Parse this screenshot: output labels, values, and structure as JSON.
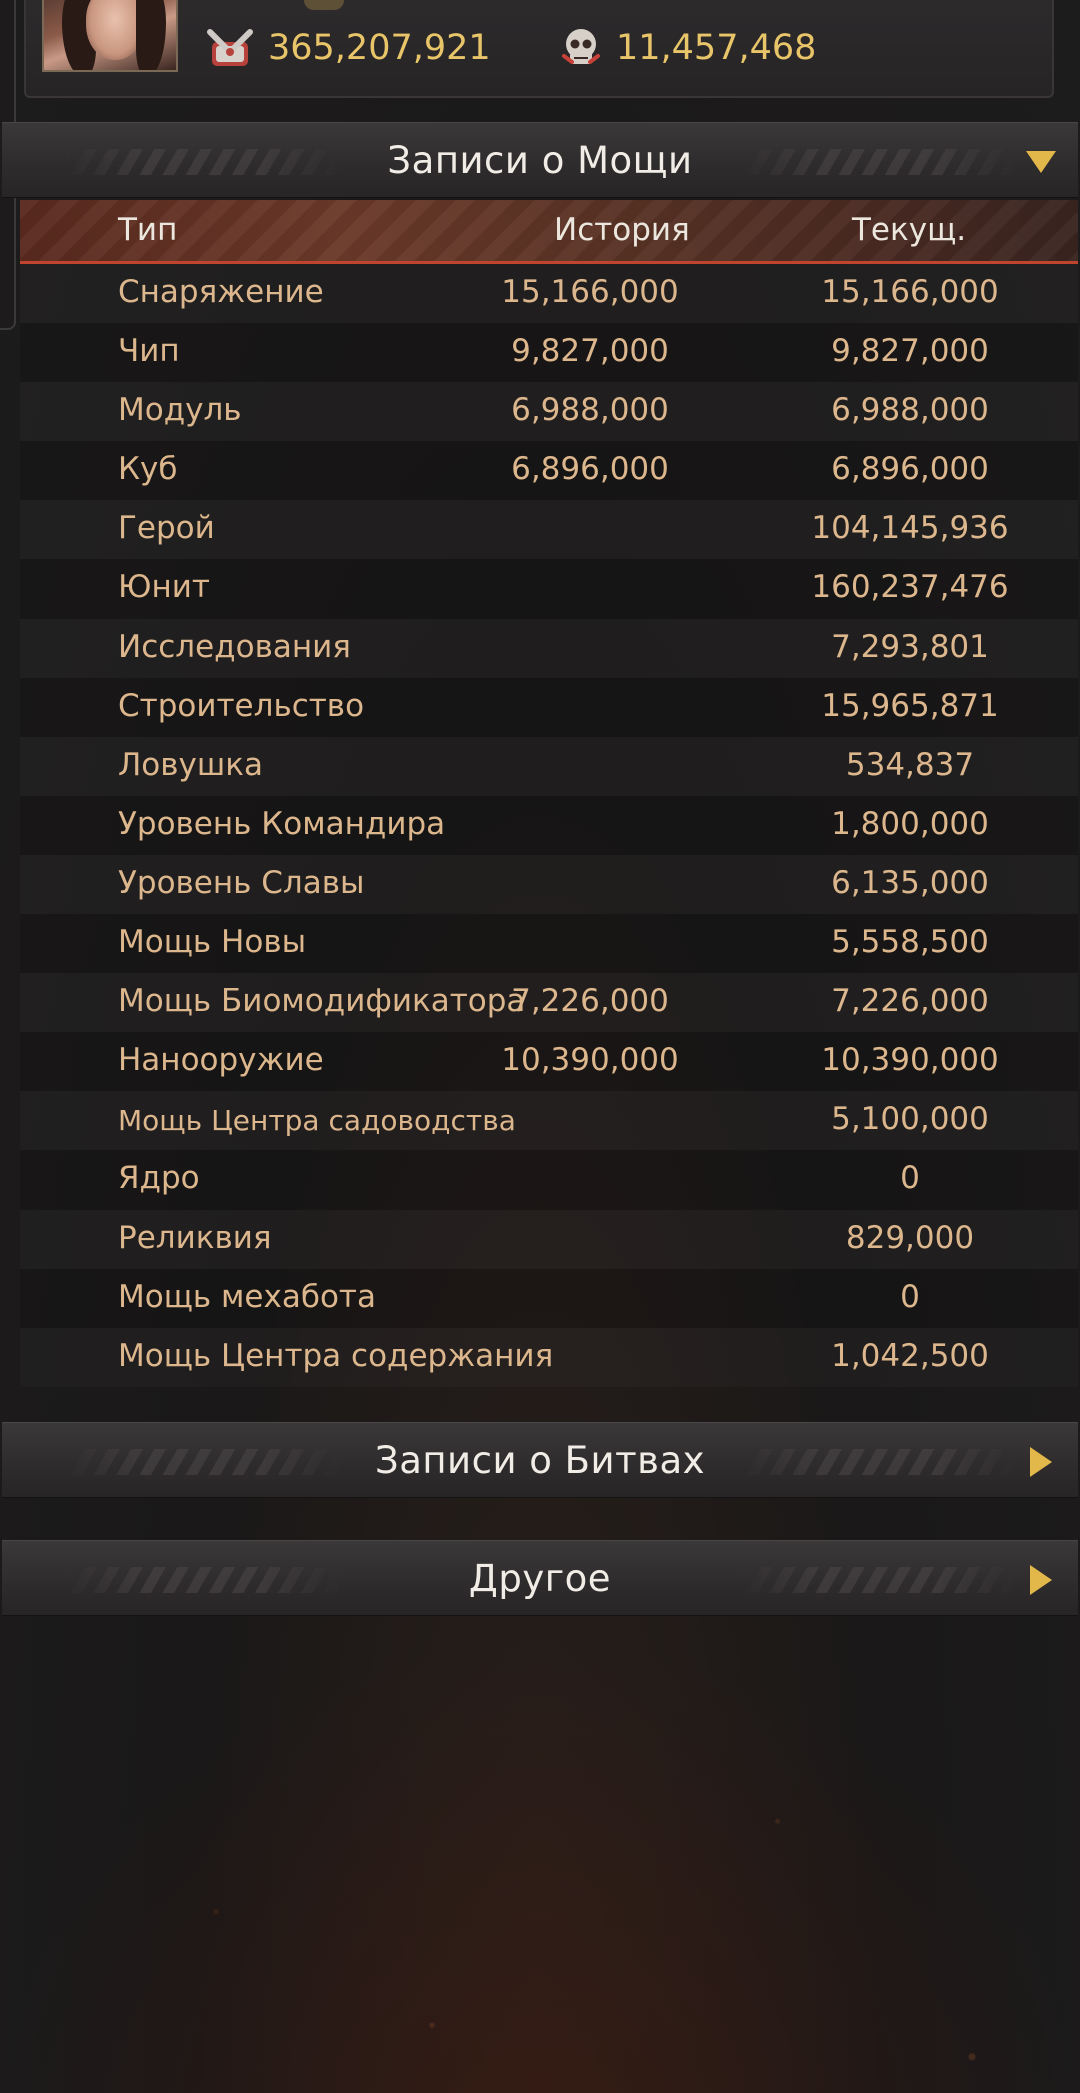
{
  "profile": {
    "stats": [
      {
        "icon": "power-fist-icon",
        "value": "365,207,921"
      },
      {
        "icon": "skull-kills-icon",
        "value": "11,457,468"
      }
    ]
  },
  "power_section": {
    "title": "Записи о Мощи",
    "expanded": true,
    "columns": {
      "type": "Тип",
      "history": "История",
      "current": "Текущ."
    },
    "rows": [
      {
        "type": "Снаряжение",
        "history": "15,166,000",
        "current": "15,166,000"
      },
      {
        "type": "Чип",
        "history": "9,827,000",
        "current": "9,827,000"
      },
      {
        "type": "Модуль",
        "history": "6,988,000",
        "current": "6,988,000"
      },
      {
        "type": "Куб",
        "history": "6,896,000",
        "current": "6,896,000"
      },
      {
        "type": "Герой",
        "history": "",
        "current": "104,145,936"
      },
      {
        "type": "Юнит",
        "history": "",
        "current": "160,237,476"
      },
      {
        "type": "Исследования",
        "history": "",
        "current": "7,293,801"
      },
      {
        "type": "Строительство",
        "history": "",
        "current": "15,965,871"
      },
      {
        "type": "Ловушка",
        "history": "",
        "current": "534,837"
      },
      {
        "type": "Уровень Командира",
        "history": "",
        "current": "1,800,000"
      },
      {
        "type": "Уровень Славы",
        "history": "",
        "current": "6,135,000"
      },
      {
        "type": "Мощь Новы",
        "history": "",
        "current": "5,558,500"
      },
      {
        "type": "Мощь Биомодификатора",
        "history": "7,226,000",
        "current": "7,226,000"
      },
      {
        "type": "Нанооружие",
        "history": "10,390,000",
        "current": "10,390,000"
      },
      {
        "type": "Мощь Центра садоводства",
        "history": "",
        "current": "5,100,000"
      },
      {
        "type": "Ядро",
        "history": "",
        "current": "0"
      },
      {
        "type": "Реликвия",
        "history": "",
        "current": "829,000"
      },
      {
        "type": "Мощь мехабота",
        "history": "",
        "current": "0"
      },
      {
        "type": "Мощь Центра содержания",
        "history": "",
        "current": "1,042,500"
      }
    ]
  },
  "battles_section": {
    "title": "Записи о Битвах",
    "expanded": false
  },
  "other_section": {
    "title": "Другое",
    "expanded": false
  },
  "colors": {
    "stat_gold": "#e9c56a",
    "row_text": "#dcb68c",
    "header_accent": "#c0442e",
    "arrow_gold": "#e2b84a"
  }
}
